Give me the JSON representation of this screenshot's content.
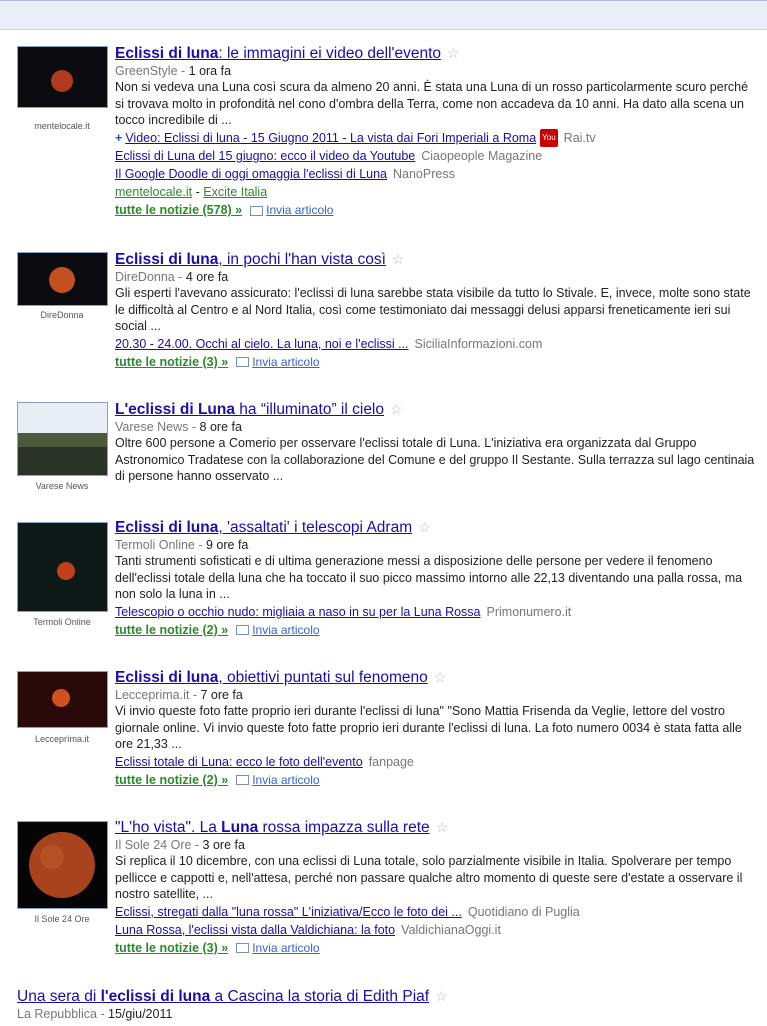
{
  "stories": [
    {
      "title_parts": [
        "Eclissi di luna",
        ": le immagini ei video dell'evento"
      ],
      "source": "GreenStyle",
      "time": "1 ora fa",
      "thumb_caption": "mentelocale.it",
      "snippet": "Non si vedeva una Luna così scura da almeno 20 anni. È stata una Luna di un rosso particolarmente scuro perché si trovava molto in profondità nel cono d'ombra della Terra, come non accadeva da 10 anni. Ha dato alla scena un tocco incredibile di ...",
      "video_link": "Video: Eclissi di luna - 15 Giugno 2011 - La vista dai Fori Imperiali a Roma",
      "video_source": "Rai.tv",
      "related": [
        {
          "text": "Eclissi di Luna del 15 giugno: ecco il video da Youtube",
          "source": "Ciaopeople Magazine"
        },
        {
          "text": "Il Google Doodle di oggi omaggia l'eclissi di Luna",
          "source": "NanoPress"
        }
      ],
      "extra_links": [
        "mentelocale.it",
        "Excite Italia"
      ],
      "all_news": "tutte le notizie (578) »",
      "send": "Invia articolo"
    },
    {
      "title_parts": [
        "Eclissi di luna",
        ", in pochi l'han vista così"
      ],
      "source": "DireDonna",
      "time": "4 ore fa",
      "thumb_caption": "DireDonna",
      "snippet": "Gli esperti l'avevano assicurato: l'eclissi di luna sarebbe stata visibile da tutto lo Stivale. E, invece, molte sono state le difficoltà al Centro e al Nord Italia, così come testimoniato dai messaggi delusi apparsi freneticamente ieri sui social ...",
      "related": [
        {
          "text": "20.30 - 24.00. Occhi al cielo. La luna, noi e l'eclissi ...",
          "source": "SiciliaInformazioni.com"
        }
      ],
      "all_news": "tutte le notizie (3) »",
      "send": "Invia articolo"
    },
    {
      "title_parts": [
        "L'eclissi di Luna",
        " ha “illuminato” il cielo"
      ],
      "source": "Varese News",
      "time": "8 ore fa",
      "thumb_caption": "Varese News",
      "snippet": "Oltre 600 persone a Comerio per osservare l'eclissi totale di Luna. L'iniziativa era organizzata dal Gruppo Astronomico Tradatese con la collaborazione del Comune e del gruppo Il Sestante. Sulla terrazza sul lago centinaia di persone hanno osservato ...",
      "related": []
    },
    {
      "title_parts": [
        "Eclissi di luna",
        ", 'assaltati' i telescopi Adram"
      ],
      "source": "Termoli Online",
      "time": "9 ore fa",
      "thumb_caption": "Termoli Online",
      "snippet": "Tanti strumenti sofisticati e di ultima generazione messi a disposizione delle persone per vedere il fenomeno dell'eclissi totale della luna che ha toccato il suo picco massimo intorno alle 22,13 diventando una palla rossa, ma non solo la luna in ...",
      "related": [
        {
          "text": "Telescopio o occhio nudo: migliaia a naso in su per la Luna Rossa",
          "source": "Primonumero.it"
        }
      ],
      "all_news": "tutte le notizie (2) »",
      "send": "Invia articolo"
    },
    {
      "title_parts": [
        "Eclissi di luna",
        ", obiettivi puntati sul fenomeno"
      ],
      "source": "Lecceprima.it",
      "time": "7 ore fa",
      "thumb_caption": "Leccepríma.it",
      "snippet": "Vi invio queste foto fatte proprio ieri durante l'eclissi di luna\" \"Sono Mattia Frisenda da Veglie, lettore del vostro giornale online. Vi invio queste foto fatte proprio ieri durante l'eclissi di luna. La foto numero 0034 è stata fatta alle ore 21,33 ...",
      "related": [
        {
          "text": "Eclissi totale di Luna: ecco le foto dell'evento",
          "source": "fanpage"
        }
      ],
      "all_news": "tutte le notizie (2) »",
      "send": "Invia articolo"
    },
    {
      "title_parts": [
        "\"L'ho vista\". La ",
        "Luna",
        " rossa impazza sulla rete"
      ],
      "source": "Il Sole 24 Ore",
      "time": "3 ore fa",
      "thumb_caption": "Il Sole 24 Ore",
      "snippet": "Si replica il 10 dicembre, con una eclissi di Luna totale, solo parzialmente visibile in Italia. Spolverare per tempo pellicce e cappotti e, nell'attesa, perché non passare qualche altro momento di queste sere d'estate a osservare il nostro satellite, ...",
      "related": [
        {
          "text": "Eclissi, stregati dalla \"luna rossa\" L'iniziativa/Ecco le foto dei ...",
          "source": "Quotidiano di Puglia"
        },
        {
          "text": "Luna Rossa, l'eclissi vista dalla Valdichiana: la foto",
          "source": "ValdichianaOggi.it"
        }
      ],
      "all_news": "tutte le notizie (3) »",
      "send": "Invia articolo"
    }
  ],
  "last": {
    "title_parts": [
      "Una sera di ",
      "l'eclissi di luna",
      " a Cascina la storia di Edith Piaf"
    ],
    "source": "La Repubblica",
    "time": "15/giu/2011"
  },
  "icons": {
    "star": "star-icon",
    "mail": "envelope-icon",
    "video": "plus-icon",
    "youtube": "youtube-icon"
  }
}
